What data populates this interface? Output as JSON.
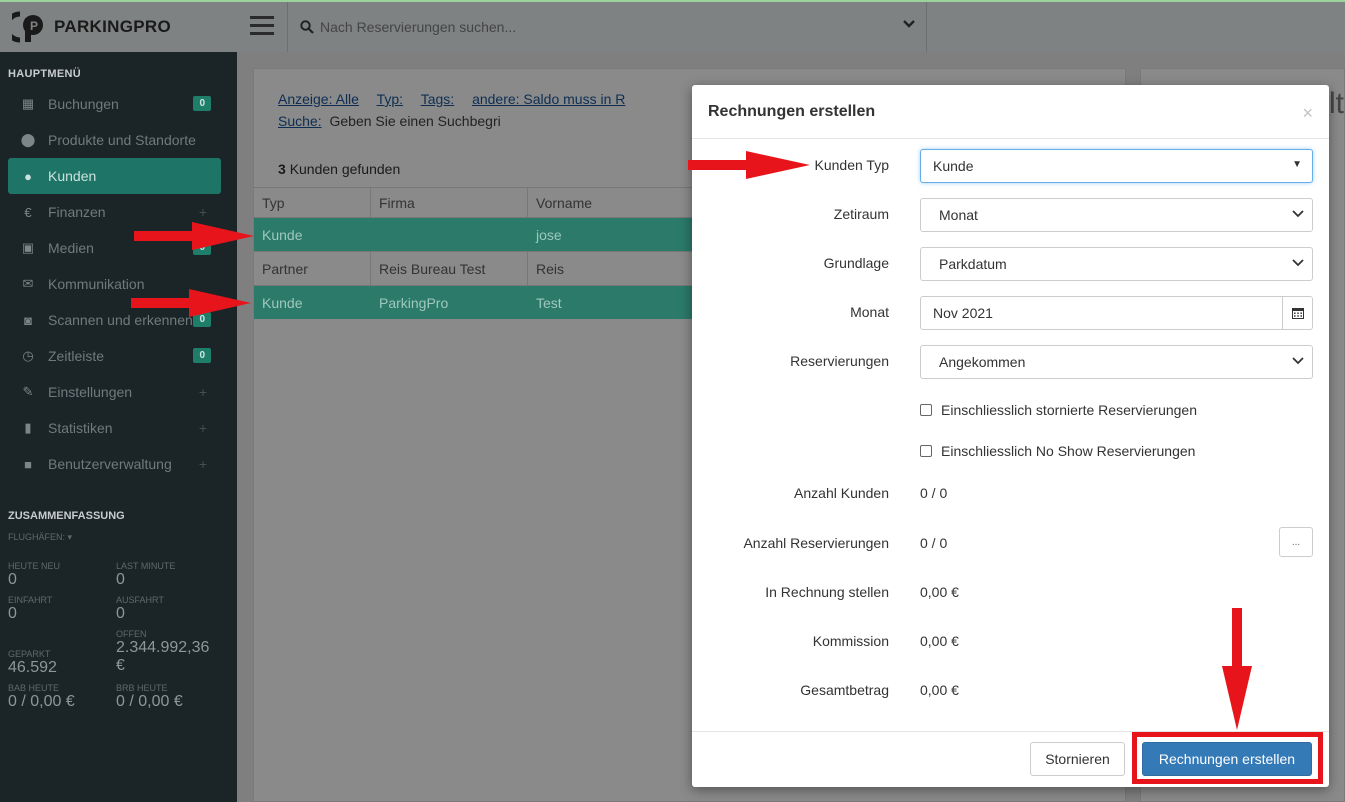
{
  "app": {
    "logo_text": "PARKINGPRO"
  },
  "topbar": {
    "search_placeholder": "Nach Reservierungen suchen..."
  },
  "sidebar": {
    "main_menu_title": "HAUPTMENÜ",
    "items": [
      {
        "label": "Buchungen",
        "icon": "calendar-icon",
        "badge": "0"
      },
      {
        "label": "Produkte und Standorte",
        "icon": "map-marker-icon"
      },
      {
        "label": "Kunden",
        "icon": "user-icon",
        "active": true
      },
      {
        "label": "Finanzen",
        "icon": "euro-icon",
        "plus": "+"
      },
      {
        "label": "Medien",
        "icon": "image-icon",
        "badge": "0"
      },
      {
        "label": "Kommunikation",
        "icon": "envelope-icon"
      },
      {
        "label": "Scannen und erkennen",
        "icon": "camera-icon",
        "badge": "0"
      },
      {
        "label": "Zeitleiste",
        "icon": "clock-icon",
        "badge": "0"
      },
      {
        "label": "Einstellungen",
        "icon": "wrench-icon",
        "plus": "+"
      },
      {
        "label": "Statistiken",
        "icon": "bar-chart-icon",
        "plus": "+"
      },
      {
        "label": "Benutzerverwaltung",
        "icon": "lock-icon",
        "plus": "+"
      }
    ],
    "summary_title": "ZUSAMMENFASSUNG",
    "airports_label": "FLUGHÄFEN:",
    "stats": {
      "heute_neu_label": "HEUTE NEU",
      "heute_neu": "0",
      "last_minute_label": "LAST MINUTE",
      "last_minute": "0",
      "einfahrt_label": "EINFAHRT",
      "einfahrt": "0",
      "ausfahrt_label": "AUSFAHRT",
      "ausfahrt": "0",
      "offen_label": "OFFEN",
      "offen": "2.344.992,36 €",
      "geparkt_label": "GEPARKT",
      "geparkt": "46.592",
      "bab_label": "BAB HEUTE",
      "bab": "0 / 0,00 €",
      "brb_label": "BRB HEUTE",
      "brb": "0 / 0,00 €"
    }
  },
  "content": {
    "filters": {
      "anzeige": "Anzeige: Alle",
      "typ": "Typ:",
      "tags": "Tags:",
      "andere": "andere: Saldo muss in R",
      "suche_label": "Suche:",
      "suche_text": "Geben Sie einen Suchbegri"
    },
    "found_count": "3",
    "found_text": "Kunden gefunden",
    "columns": [
      "Typ",
      "Firma",
      "Vorname"
    ],
    "rows": [
      {
        "typ": "Kunde",
        "firma": "",
        "vorname": "jose",
        "selected": true
      },
      {
        "typ": "Partner",
        "firma": "Reis Bureau Test",
        "vorname": "Reis",
        "selected": false
      },
      {
        "typ": "Kunde",
        "firma": "ParkingPro",
        "vorname": "Test",
        "selected": true
      }
    ],
    "right_fragment": "lt"
  },
  "modal": {
    "title": "Rechnungen erstellen",
    "close": "×",
    "fields": {
      "kunden_typ_label": "Kunden Typ",
      "kunden_typ_value": "Kunde",
      "zeitraum_label": "Zetiraum",
      "zeitraum_value": "Monat",
      "grundlage_label": "Grundlage",
      "grundlage_value": "Parkdatum",
      "monat_label": "Monat",
      "monat_value": "Nov 2021",
      "reservierungen_label": "Reservierungen",
      "reservierungen_value": "Angekommen"
    },
    "checkboxes": {
      "storniert": "Einschliesslich stornierte Reservierungen",
      "noshow": "Einschliesslich No Show Reservierungen"
    },
    "summary": {
      "anzahl_kunden_label": "Anzahl Kunden",
      "anzahl_kunden": "0 / 0",
      "anzahl_res_label": "Anzahl Reservierungen",
      "anzahl_res": "0 / 0",
      "dots": "...",
      "in_rechnung_label": "In Rechnung stellen",
      "in_rechnung": "0,00 €",
      "kommission_label": "Kommission",
      "kommission": "0,00 €",
      "gesamt_label": "Gesamtbetrag",
      "gesamt": "0,00 €"
    },
    "buttons": {
      "cancel": "Stornieren",
      "create": "Rechnungen erstellen"
    }
  },
  "colors": {
    "accent": "#337ab7",
    "teal": "#1e7466",
    "annotation_red": "#e8141c"
  }
}
